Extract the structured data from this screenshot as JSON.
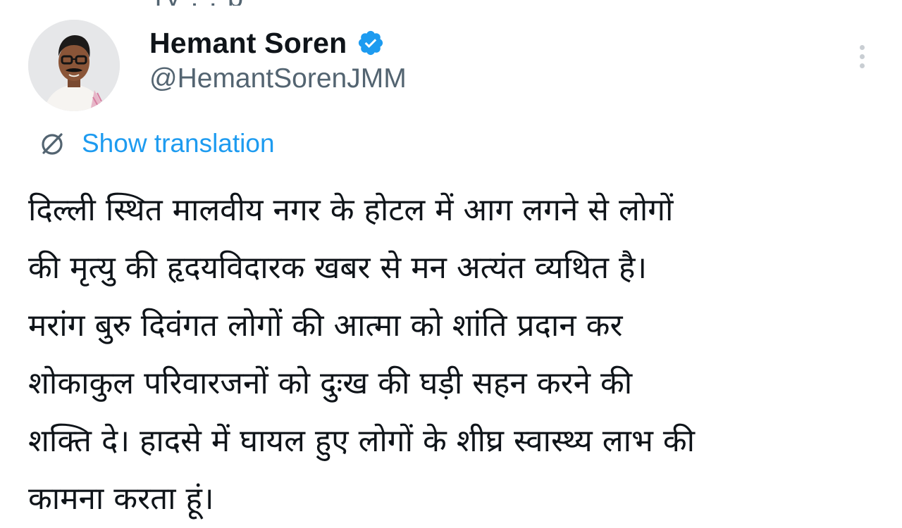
{
  "top_partial_text": "ry  ,  ,  p",
  "author": {
    "display_name": "Hemant Soren",
    "handle": "@HemantSorenJMM",
    "verified": true,
    "avatar": "profile-photo"
  },
  "menu": {
    "icon": "more-vertical-icon"
  },
  "translation": {
    "label": "Show translation",
    "icon": "translate-icon"
  },
  "tweet": {
    "lines": [
      "दिल्ली स्थित मालवीय नगर के होटल में आग लगने से लोगों",
      "की मृत्यु की हृदयविदारक खबर से मन अत्यंत व्यथित है।",
      "मरांग बुरु दिवंगत लोगों की आत्मा को शांति प्रदान कर",
      "शोकाकुल परिवारजनों को दुःख की घड़ी सहन करने की",
      "शक्ति दे। हादसे में घायल हुए लोगों के शीघ्र स्वास्थ्य लाभ की",
      "कामना करता हूं।"
    ]
  },
  "colors": {
    "primary_text": "#0f1419",
    "secondary_text": "#536471",
    "link": "#1d9bf0",
    "verified_badge": "#1d9bf0",
    "background": "#ffffff"
  }
}
